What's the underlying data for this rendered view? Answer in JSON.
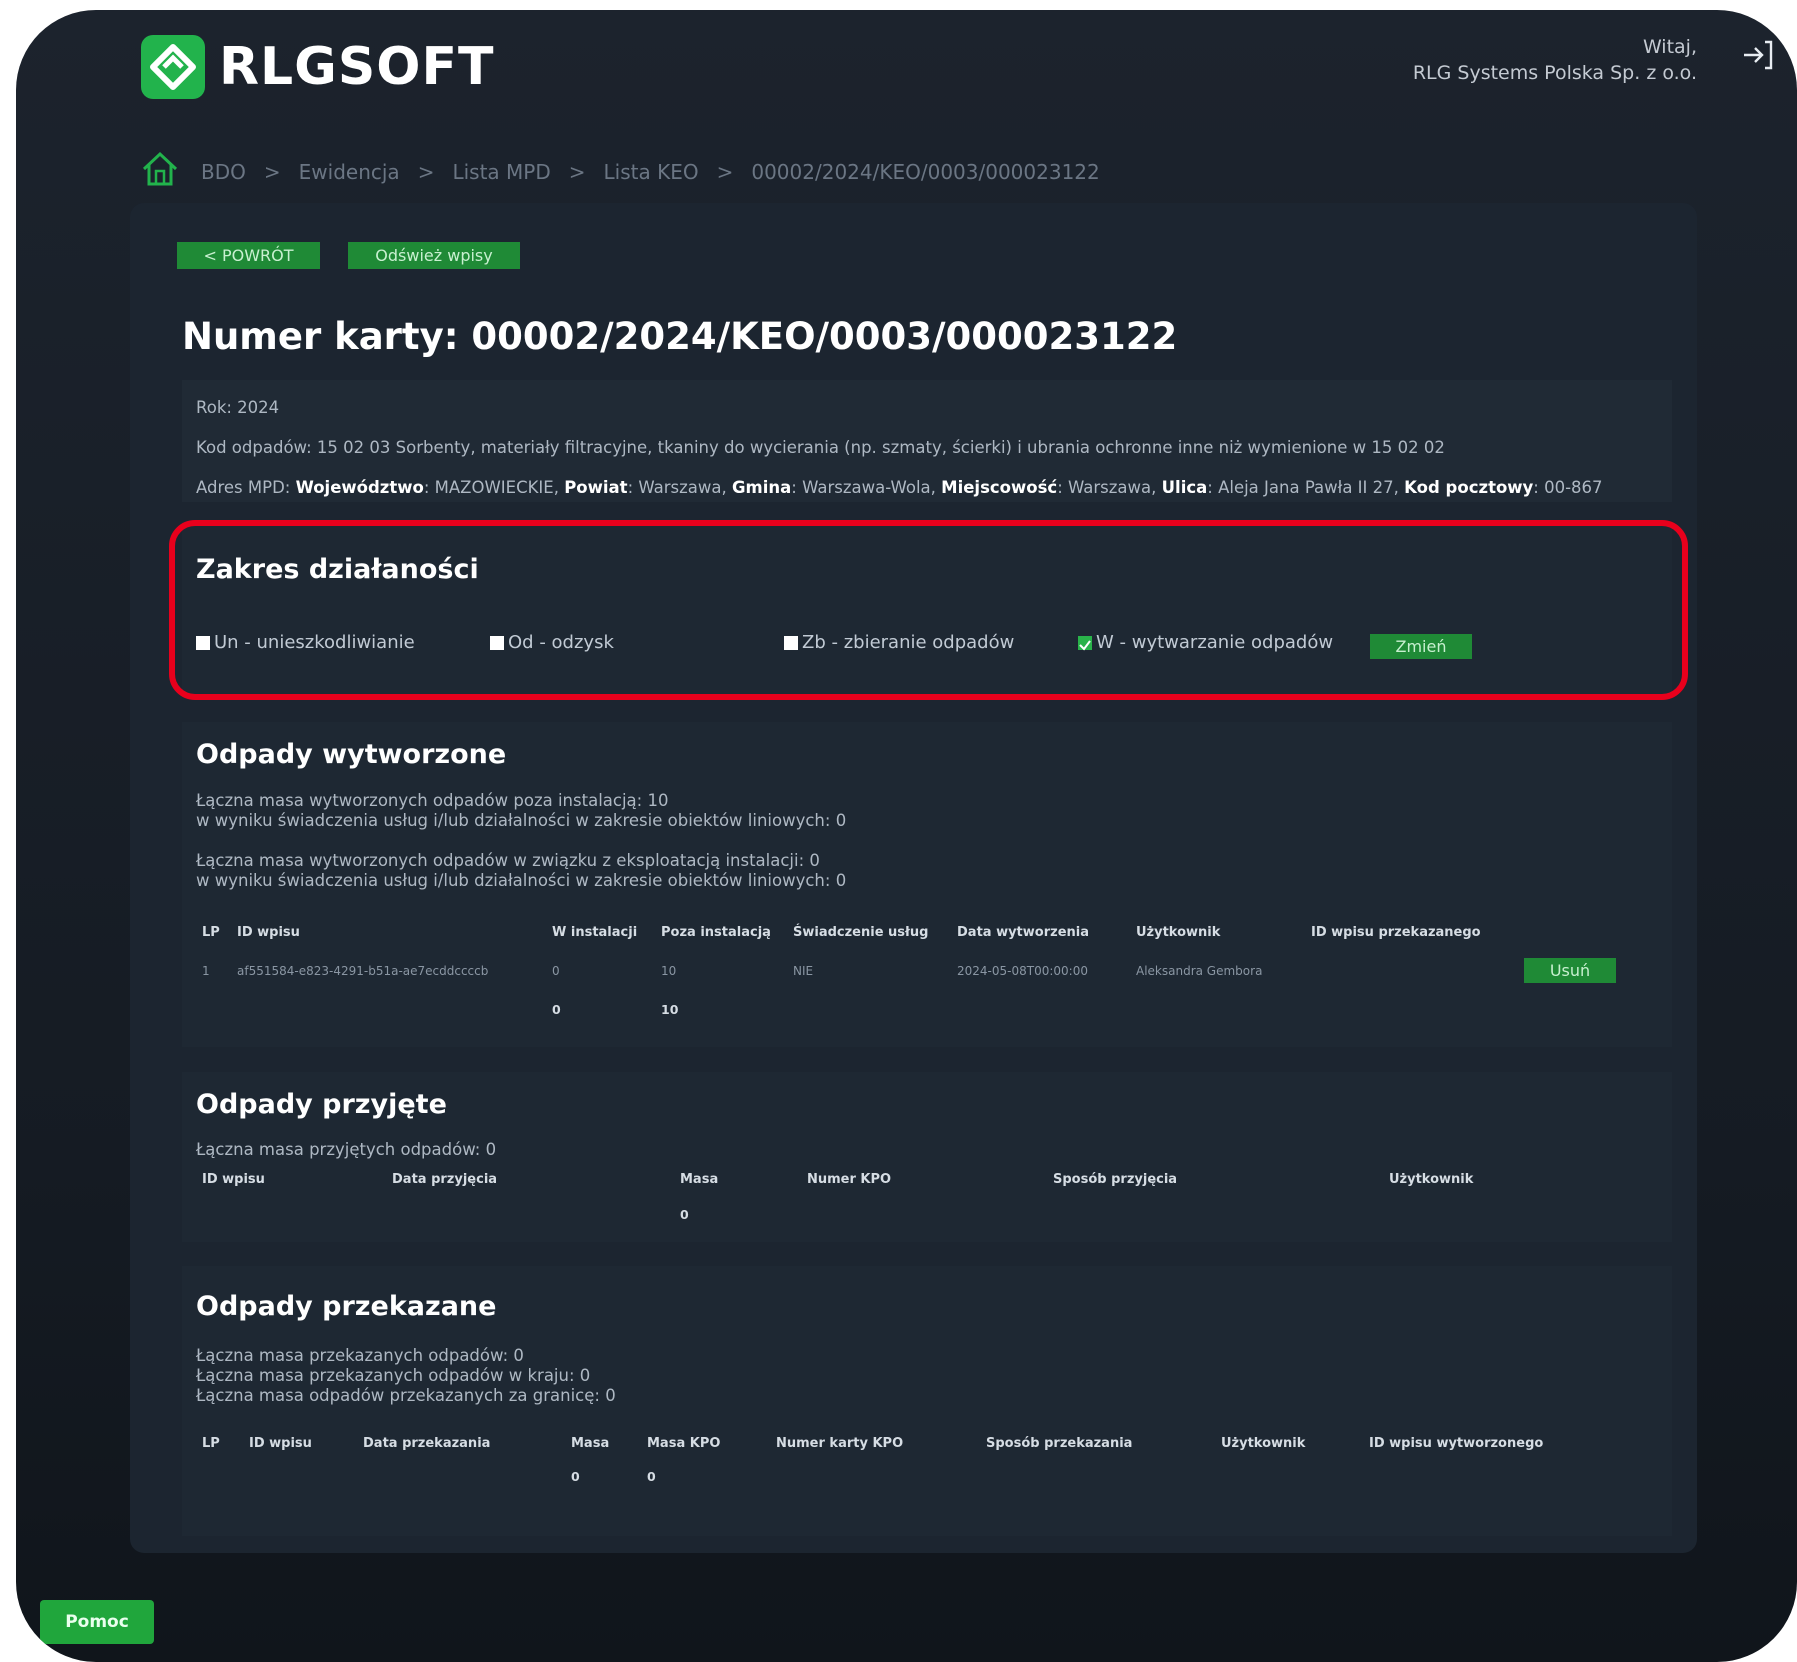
{
  "header": {
    "logo_text": "RLGSOFT",
    "greeting": "Witaj,",
    "company": "RLG Systems Polska Sp. z o.o.",
    "brand_color": "#22b34c"
  },
  "breadcrumb": [
    "BDO",
    "Ewidencja",
    "Lista MPD",
    "Lista KEO",
    "00002/2024/KEO/0003/000023122"
  ],
  "toolbar": {
    "back_label": "< POWRÓT",
    "refresh_label": "Odśwież wpisy"
  },
  "card": {
    "title": "Numer karty: 00002/2024/KEO/0003/000023122",
    "year_line": "Rok: 2024",
    "code_line": "Kod odpadów: 15 02 03 Sorbenty, materiały filtracyjne, tkaniny do wycierania (np. szmaty, ścierki) i ubrania ochronne inne niż wymienione w 15 02 02",
    "address": {
      "prefix": "Adres MPD: ",
      "k1": "Województwo",
      "v1": ": MAZOWIECKIE, ",
      "k2": "Powiat",
      "v2": ": Warszawa, ",
      "k3": "Gmina",
      "v3": ": Warszawa-Wola, ",
      "k4": "Miejscowość",
      "v4": ": Warszawa, ",
      "k5": "Ulica",
      "v5": ": Aleja Jana Pawła II 27, ",
      "k6": "Kod pocztowy",
      "v6": ": 00-867"
    }
  },
  "scope": {
    "title": "Zakres działaności",
    "options": [
      {
        "label": "Un - unieszkodliwianie",
        "checked": false
      },
      {
        "label": "Od - odzysk",
        "checked": false
      },
      {
        "label": "Zb - zbieranie odpadów",
        "checked": false
      },
      {
        "label": "W - wytwarzanie odpadów",
        "checked": true
      }
    ],
    "change_label": "Zmień"
  },
  "produced": {
    "title": "Odpady wytworzone",
    "lines": [
      "Łączna masa wytworzonych odpadów poza instalacją: 10",
      "w wyniku świadczenia usług i/lub działalności w zakresie obiektów liniowych: 0",
      "Łączna masa wytworzonych odpadów w związku z eksploatacją instalacji: 0",
      "w wyniku świadczenia usług i/lub działalności w zakresie obiektów liniowych: 0"
    ],
    "columns": [
      "LP",
      "ID wpisu",
      "W instalacji",
      "Poza instalacją",
      "Świadczenie usług",
      "Data wytworzenia",
      "Użytkownik",
      "ID wpisu przekazanego"
    ],
    "rows": [
      {
        "lp": "1",
        "id": "af551584-e823-4291-b51a-ae7ecddccccb",
        "w_inst": "0",
        "poza": "10",
        "swiad": "NIE",
        "data": "2024-05-08T00:00:00",
        "user": "Aleksandra Gembora",
        "id_przek": ""
      }
    ],
    "totals": {
      "w_inst": "0",
      "poza": "10"
    },
    "delete_label": "Usuń"
  },
  "accepted": {
    "title": "Odpady przyjęte",
    "line": "Łączna masa przyjętych odpadów: 0",
    "columns": [
      "ID wpisu",
      "Data przyjęcia",
      "Masa",
      "Numer KPO",
      "Sposób przyjęcia",
      "Użytkownik"
    ],
    "total_masa": "0"
  },
  "transferred": {
    "title": "Odpady przekazane",
    "lines": [
      "Łączna masa przekazanych odpadów: 0",
      "Łączna masa przekazanych odpadów w kraju: 0",
      "Łączna masa odpadów przekazanych za granicę: 0"
    ],
    "columns": [
      "LP",
      "ID wpisu",
      "Data przekazania",
      "Masa",
      "Masa KPO",
      "Numer karty KPO",
      "Sposób przekazania",
      "Użytkownik",
      "ID wpisu wytworzonego"
    ],
    "totals": {
      "masa": "0",
      "masa_kpo": "0"
    }
  },
  "help_label": "Pomoc"
}
